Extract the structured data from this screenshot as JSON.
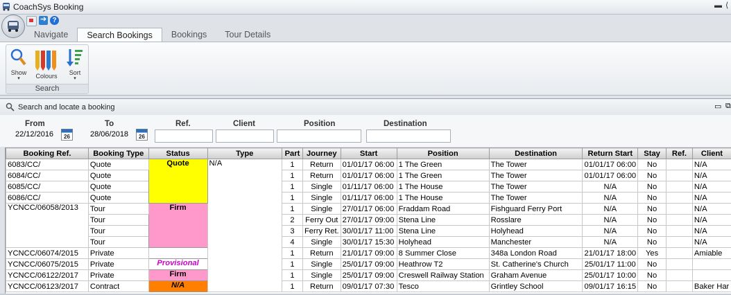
{
  "app": {
    "title": "CoachSys Booking"
  },
  "tabs": [
    {
      "label": "Navigate"
    },
    {
      "label": "Search Bookings"
    },
    {
      "label": "Bookings"
    },
    {
      "label": "Tour Details"
    }
  ],
  "ribbon": {
    "show_label": "Show",
    "colours_label": "Colours",
    "sort_label": "Sort",
    "group_label": "Search"
  },
  "panel": {
    "title": "Search and locate a booking"
  },
  "filters": {
    "from_label": "From",
    "from_value": "22/12/2016",
    "to_label": "To",
    "to_value": "28/06/2018",
    "calendar_day": "26",
    "ref_label": "Ref.",
    "client_label": "Client",
    "position_label": "Position",
    "destination_label": "Destination",
    "ref_value": "",
    "client_value": "",
    "position_value": "",
    "destination_value": ""
  },
  "colors": {
    "quote": "#ffff00",
    "firm": "#ff99cc",
    "provisional_text": "#cc00cc",
    "contract": "#ff8000"
  },
  "table": {
    "headers": [
      "Booking Ref.",
      "Booking Type",
      "Status",
      "Type",
      "Part",
      "Journey",
      "Start",
      "Position",
      "Destination",
      "Return Start",
      "Stay",
      "Ref.",
      "Client"
    ],
    "rows": [
      [
        "6083/CC/",
        "Quote",
        "Quote",
        "N/A",
        "1",
        "Return",
        "01/01/17 06:00",
        "1 The Green",
        "The Tower",
        "01/01/17 06:00",
        "No",
        "",
        "N/A"
      ],
      [
        "6084/CC/",
        "Quote",
        "",
        "",
        "1",
        "Return",
        "01/01/17 06:00",
        "1 The Green",
        "The Tower",
        "01/01/17 06:00",
        "No",
        "",
        "N/A"
      ],
      [
        "6085/CC/",
        "Quote",
        "",
        "",
        "1",
        "Single",
        "01/11/17 06:00",
        "1 The House",
        "The Tower",
        "N/A",
        "No",
        "",
        "N/A"
      ],
      [
        "6086/CC/",
        "Quote",
        "",
        "",
        "1",
        "Single",
        "01/11/17 06:00",
        "1 The House",
        "The Tower",
        "N/A",
        "No",
        "",
        "N/A"
      ],
      [
        "YCNCC/06058/2013",
        "Tour",
        "Firm",
        "",
        "1",
        "Single",
        "27/01/17 06:00",
        "Fraddam Road",
        "Fishguard Ferry Port",
        "N/A",
        "No",
        "",
        "N/A"
      ],
      [
        "",
        "Tour",
        "",
        "",
        "2",
        "Ferry Out",
        "27/01/17 09:00",
        "Stena Line",
        "Rosslare",
        "N/A",
        "No",
        "",
        "N/A"
      ],
      [
        "",
        "Tour",
        "",
        "",
        "3",
        "Ferry Ret.",
        "30/01/17 11:00",
        "Stena Line",
        "Holyhead",
        "N/A",
        "No",
        "",
        "N/A"
      ],
      [
        "",
        "Tour",
        "",
        "",
        "4",
        "Single",
        "30/01/17 15:30",
        "Holyhead",
        "Manchester",
        "N/A",
        "No",
        "",
        "N/A"
      ],
      [
        "YCNCC/06074/2015",
        "Private",
        "",
        "",
        "1",
        "Return",
        "21/01/17 09:00",
        "8 Summer Close",
        "348a London Road",
        "21/01/17 18:00",
        "Yes",
        "",
        "Amiable"
      ],
      [
        "YCNCC/06075/2015",
        "Private",
        "Provisional",
        "",
        "1",
        "Single",
        "25/01/17 09:00",
        "Heathrow T2",
        "St. Catherine's Church",
        "25/01/17 11:00",
        "No",
        "",
        ""
      ],
      [
        "YCNCC/06122/2017",
        "Private",
        "Firm",
        "",
        "1",
        "Single",
        "25/01/17 09:00",
        "Creswell Railway Station",
        "Graham Avenue",
        "25/01/17 10:00",
        "No",
        "",
        ""
      ],
      [
        "YCNCC/06123/2017",
        "Contract",
        "N/A",
        "",
        "1",
        "Return",
        "09/01/17 07:30",
        "Tesco",
        "Grintley School",
        "09/01/17 16:15",
        "No",
        "",
        "Baker Har"
      ]
    ]
  }
}
